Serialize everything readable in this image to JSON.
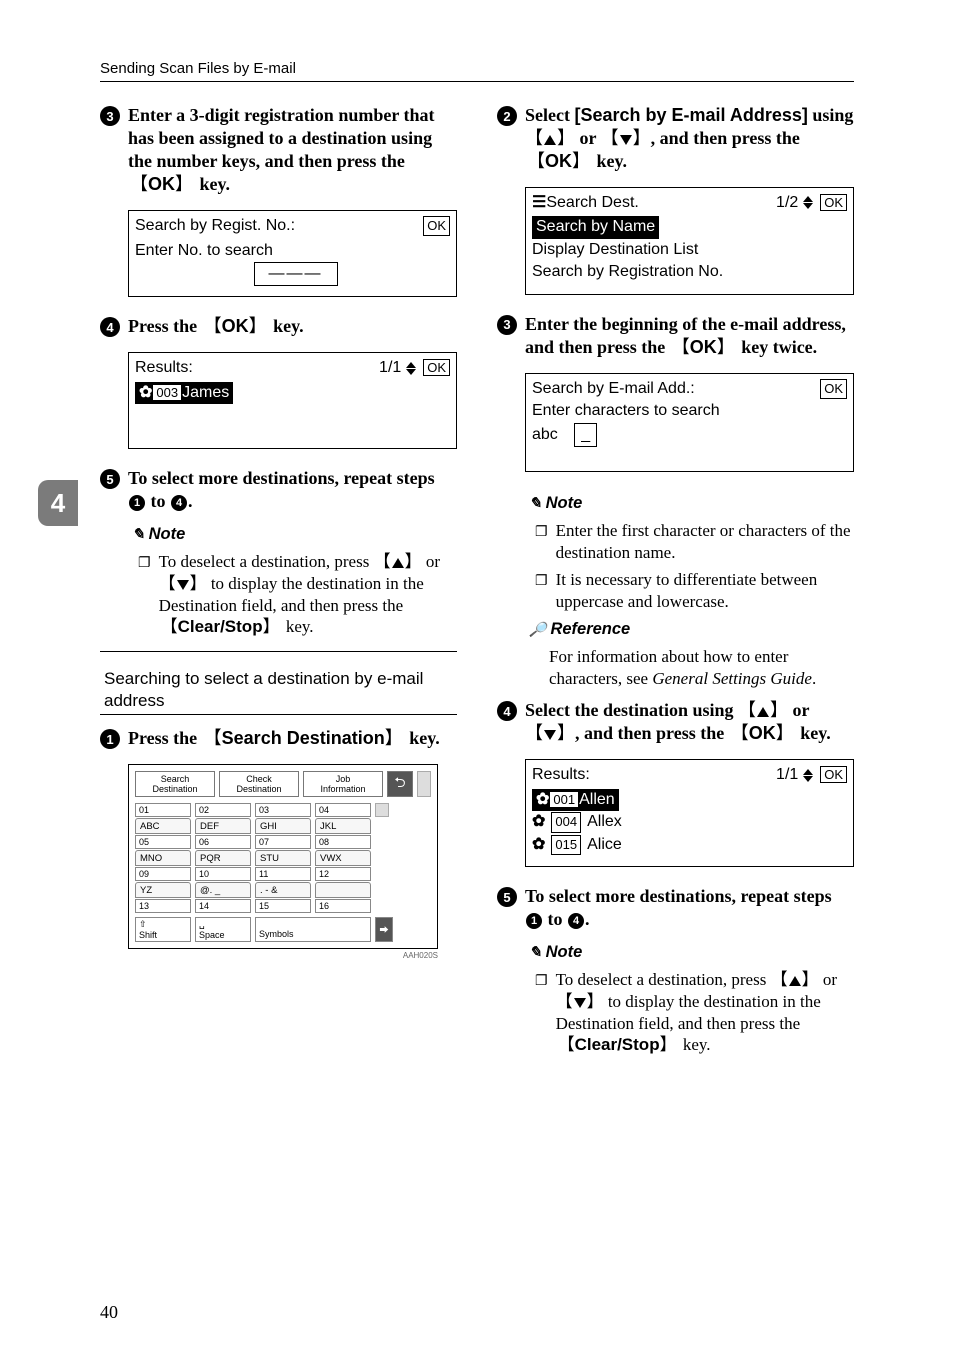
{
  "header": {
    "running": "Sending Scan Files by E-mail"
  },
  "side_tab": {
    "label": "4"
  },
  "page_number": "40",
  "left": {
    "step3": "Enter a 3-digit registration number that has been assigned to a destination using the number keys, and then press the ",
    "step3_key": "OK",
    "step3_tail": " key.",
    "lcd1": {
      "title": "Search by Regist. No.:",
      "line2": "Enter No. to search",
      "input": "———"
    },
    "step4": "Press the ",
    "step4_key": "OK",
    "step4_tail": " key.",
    "lcd2": {
      "title": "Results:",
      "count": "1/1",
      "item_num": "003",
      "item_name": "James"
    },
    "step5_a": "To select more destinations, repeat steps ",
    "step5_b": " to ",
    "step5_c": ".",
    "note_label": "Note",
    "note_body_a": "To deselect a destination, press ",
    "note_body_b": " or ",
    "note_body_c": " to display the destination in the Destination field, and then press the ",
    "note_body_key": "Clear/Stop",
    "note_body_d": " key.",
    "section": "Searching to select a destination by e-mail address",
    "step1": "Press the ",
    "step1_key": "Search Destination",
    "step1_tail": " key.",
    "keyboard_caption": "AAH020S",
    "kb_top": {
      "a": "Search",
      "a2": "Destination",
      "b": "Check",
      "b2": "Destination",
      "c": "Job",
      "c2": "Information"
    },
    "kb_nums_r1": [
      "01",
      "02",
      "03",
      "04"
    ],
    "kb_alpha_r1": [
      "ABC",
      "DEF",
      "GHI",
      "JKL"
    ],
    "kb_nums_r2": [
      "05",
      "06",
      "07",
      "08"
    ],
    "kb_alpha_r2": [
      "MNO",
      "PQR",
      "STU",
      "VWX"
    ],
    "kb_nums_r3": [
      "09",
      "10",
      "11",
      "12"
    ],
    "kb_alpha_r3": [
      "YZ",
      "@. _",
      ". - &",
      ""
    ],
    "kb_nums_r4": [
      "13",
      "14",
      "15",
      "16"
    ],
    "kb_bottom": {
      "shift_icon": "⇧",
      "shift": "Shift",
      "space_icon": "␣",
      "space": "Space",
      "symbols": "Symbols"
    }
  },
  "right": {
    "step2_a": "Select ",
    "step2_b": "[Search by E-mail Address]",
    "step2_c": " using ",
    "step2_d": " or ",
    "step2_e": ", and then press the ",
    "step2_key": "OK",
    "step2_f": " key.",
    "lcd1": {
      "icon": "☰",
      "title": "Search Dest.",
      "count": "1/2",
      "sel": "Search by Name",
      "l2": "Display Destination List",
      "l3": "Search by Registration No."
    },
    "step3_a": "Enter the beginning of the e-mail address, and then press the ",
    "step3_key": "OK",
    "step3_b": " key twice.",
    "lcd2": {
      "title": "Search by E-mail Add.:",
      "l2": "Enter characters to search",
      "prefix": "abc",
      "caret": "_"
    },
    "note_label": "Note",
    "note1": "Enter the first character or characters of the destination name.",
    "note2": "It is necessary to differentiate between uppercase and lowercase.",
    "ref_label": "Reference",
    "ref_body_a": "For information about how to enter characters, see ",
    "ref_body_i": "General Settings Guide",
    "ref_body_b": ".",
    "step4_a": "Select the destination using ",
    "step4_b": " or ",
    "step4_c": ", and then press the ",
    "step4_key": "OK",
    "step4_d": " key.",
    "lcd3": {
      "title": "Results:",
      "count": "1/1",
      "r1_num": "001",
      "r1_name": "Allen",
      "r2_num": "004",
      "r2_name": "Allex",
      "r3_num": "015",
      "r3_name": "Alice"
    },
    "step5_a": "To select more destinations, repeat steps ",
    "step5_b": " to ",
    "step5_c": ".",
    "note2_label": "Note",
    "note2_body_a": "To deselect a destination, press ",
    "note2_body_b": " or ",
    "note2_body_c": " to display the destination in the Destination field, and then press the ",
    "note2_body_key": "Clear/Stop",
    "note2_body_d": " key."
  }
}
